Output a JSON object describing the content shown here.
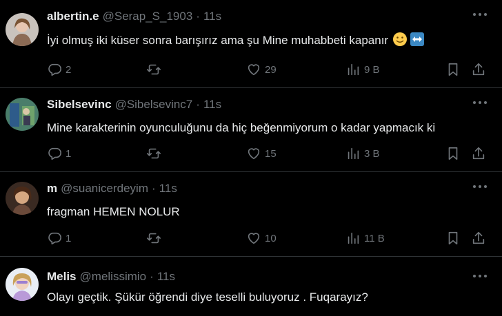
{
  "tweets": [
    {
      "name": "albertin.e",
      "handle": "@Serap_S_1903",
      "separator": "·",
      "time": "11s",
      "text": "İyi olmuş iki küser sonra barışırız ama şu Mine muhabbeti kapanır",
      "emojis": [
        "slightly-smiling-face-emoji",
        "left-right-arrow-emoji"
      ],
      "replies": "2",
      "retweets": "",
      "likes": "29",
      "views": "9 B"
    },
    {
      "name": "Sibelsevinc",
      "handle": "@Sibelsevinc7",
      "separator": "·",
      "time": "11s",
      "text": "Mine karakterinin oyunculuğunu da hiç beğenmiyorum o kadar yapmacık ki",
      "replies": "1",
      "retweets": "",
      "likes": "15",
      "views": "3 B"
    },
    {
      "name": "m",
      "handle": "@suanicerdeyim",
      "separator": "·",
      "time": "11s",
      "text": "fragman HEMEN NOLUR",
      "replies": "1",
      "retweets": "",
      "likes": "10",
      "views": "11 B"
    },
    {
      "name": "Melis",
      "handle": "@melissimio",
      "separator": "·",
      "time": "11s",
      "text": "Olayı geçtik. Şükür öğrendi diye teselli buluyoruz . Fuqarayız?"
    }
  ],
  "colors": {
    "background": "#000000",
    "text": "#e7e9ea",
    "muted": "#71767b",
    "divider": "#2f3336",
    "emoji_smile": "#ffcc4d",
    "emoji_arrow": "#3b88c3"
  },
  "icons": [
    "reply-icon",
    "retweet-icon",
    "like-icon",
    "views-icon",
    "bookmark-icon",
    "share-icon",
    "more-icon"
  ]
}
